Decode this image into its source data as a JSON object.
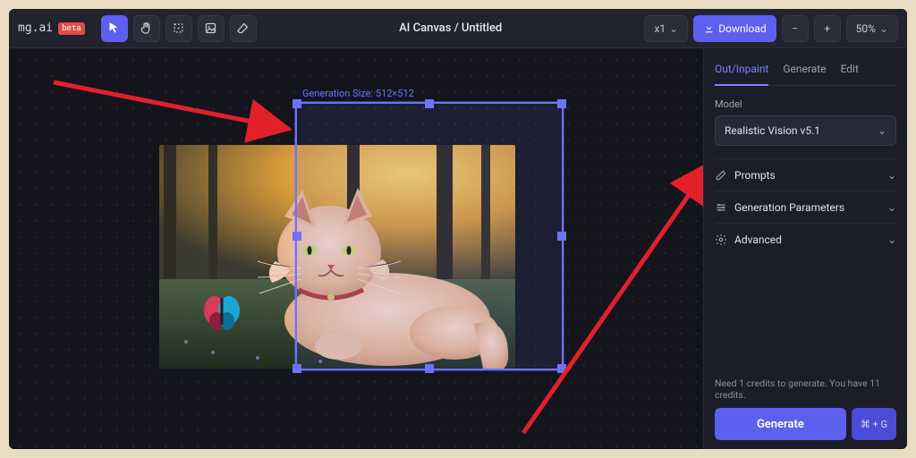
{
  "brand": {
    "name": "mg.ai",
    "badge": "beta"
  },
  "title": "AI Canvas / Untitled",
  "toolbar": {
    "zoom_label": "x1",
    "download_label": "Download",
    "zoom_pct": "50%"
  },
  "canvas": {
    "selection_label": "Generation Size: 512×512"
  },
  "panel": {
    "tabs": {
      "outinpaint": "Out/Inpaint",
      "generate": "Generate",
      "edit": "Edit"
    },
    "model_label": "Model",
    "model_value": "Realistic Vision v5.1",
    "section_prompts": "Prompts",
    "section_params": "Generation Parameters",
    "section_advanced": "Advanced",
    "credits_text": "Need 1 credits to generate. You have 11 credits.",
    "generate_label": "Generate",
    "hotkey_label": "⌘ + G"
  }
}
